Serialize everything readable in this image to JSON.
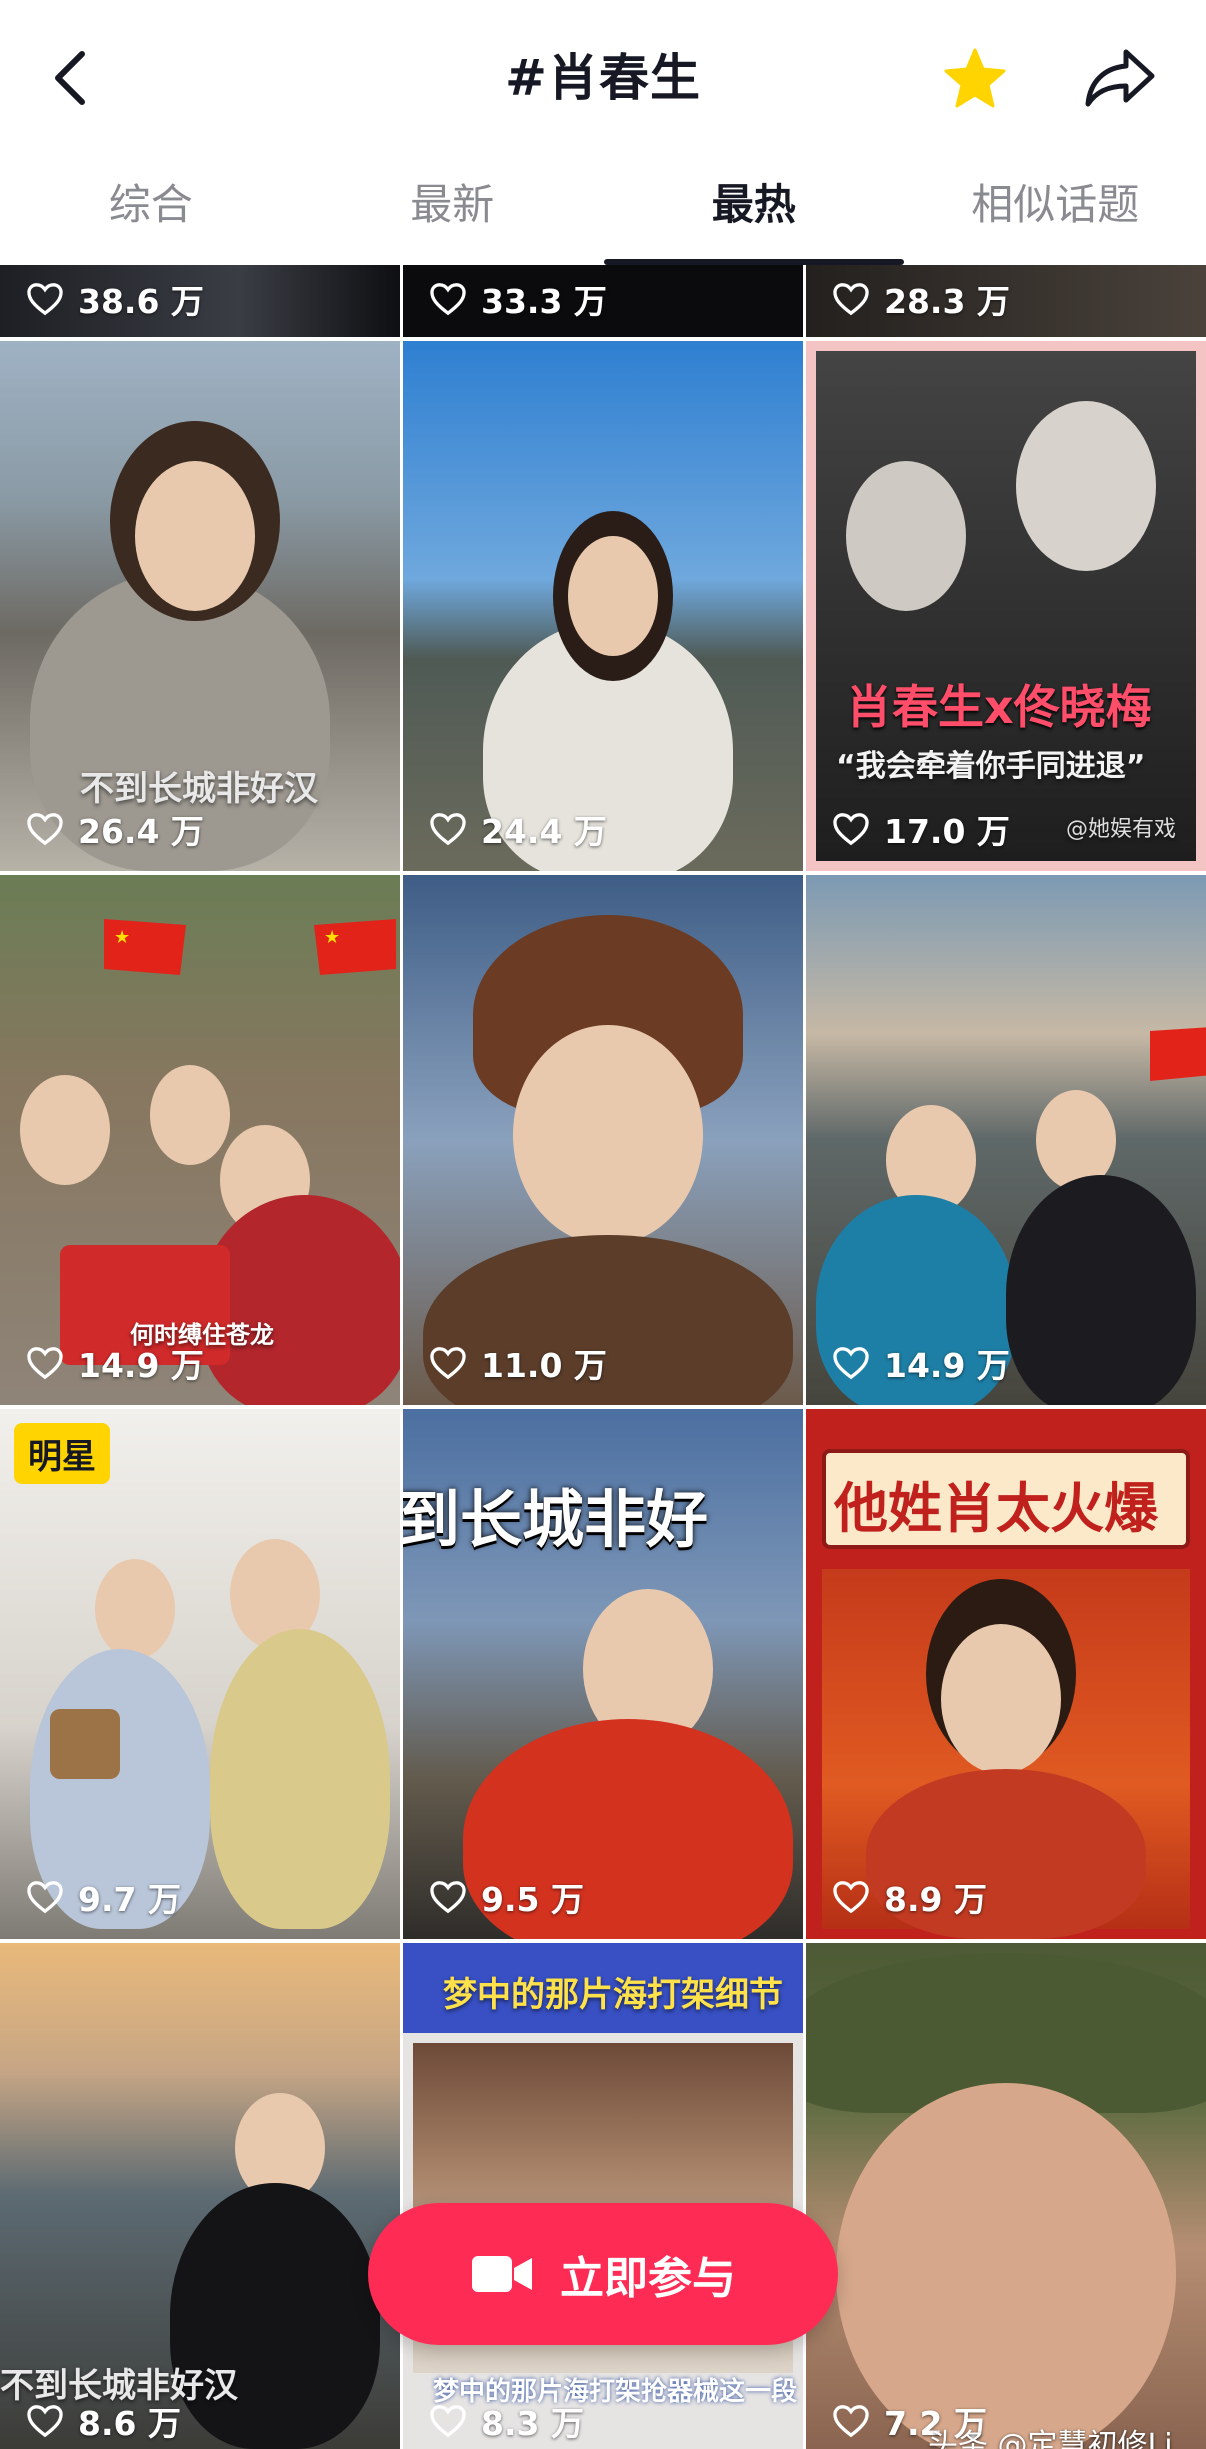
{
  "header": {
    "title": "#肖春生",
    "back_icon": "chevron-left-icon",
    "favorite_icon": "star-icon",
    "share_icon": "share-arrow-icon",
    "favorite_color": "#ffd400"
  },
  "tabs": [
    {
      "label": "综合",
      "active": false
    },
    {
      "label": "最新",
      "active": false
    },
    {
      "label": "最热",
      "active": true
    },
    {
      "label": "相似话题",
      "active": false
    }
  ],
  "videos": [
    {
      "likes": "38.6 万"
    },
    {
      "likes": "33.3 万"
    },
    {
      "likes": "28.3 万"
    },
    {
      "likes": "26.4 万",
      "caption": "不到长城非好汉"
    },
    {
      "likes": "24.4 万"
    },
    {
      "likes": "17.0 万",
      "caption": "肖春生x佟晓梅",
      "subcaption": "“我会牵着你手同进退”",
      "credit": "@她娱有戏"
    },
    {
      "likes": "14.9 万",
      "caption": "何时缚住苍龙"
    },
    {
      "likes": "11.0 万"
    },
    {
      "likes": "14.9 万"
    },
    {
      "likes": "9.7 万",
      "badge": "明星"
    },
    {
      "likes": "9.5 万",
      "caption": "到长城非好"
    },
    {
      "likes": "8.9 万",
      "caption": "他姓肖太火爆"
    },
    {
      "likes": "8.6 万",
      "caption": "不到长城非好汉"
    },
    {
      "likes": "8.3 万",
      "caption": "梦中的那片海打架细节",
      "subcaption": "梦中的那片海打架抢器械这一段"
    },
    {
      "likes": "7.2 万"
    }
  ],
  "cta": {
    "label": "立即参与",
    "icon": "video-camera-icon",
    "color": "#fe2c55"
  },
  "watermark": "头条 @定慧初修Li"
}
